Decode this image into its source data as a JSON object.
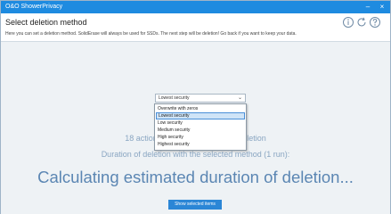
{
  "window": {
    "title": "O&O ShowerPrivacy",
    "minimize_glyph": "–",
    "close_glyph": "×"
  },
  "header": {
    "title": "Select deletion method",
    "description": "Here you can set a deletion method. SolidErase will always be used for SSDs. The next step will be deletion! Go back if you want to keep your data.",
    "icons": [
      "help-icon",
      "refresh-icon",
      "question-icon"
    ]
  },
  "method_select": {
    "selected": "Lowest security",
    "chevron": "⌄",
    "options": [
      "Overwrite with zeros",
      "Lowest security",
      "Low security",
      "Medium security",
      "High security",
      "Highest security"
    ],
    "highlighted_index": 1
  },
  "summary": {
    "actions_text_a": "18 actions (",
    "actions_text_b": "re deletion",
    "duration_text": "Duration of deletion with the selected method (1 run):",
    "calculating_text": "Calculating estimated duration of deletion..."
  },
  "buttons": {
    "show_selected_items": "Show selected items"
  },
  "colors": {
    "titlebar": "#1e8be0",
    "accent": "#2b86d6",
    "text_light": "#8aa6c2",
    "text_heading": "#5b86b3"
  }
}
